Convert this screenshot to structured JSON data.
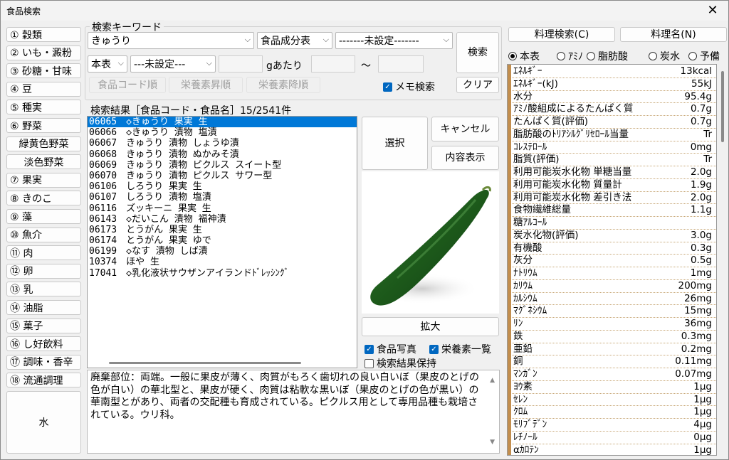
{
  "window": {
    "title": "食品検索",
    "close_glyph": "✕"
  },
  "categories": [
    "① 穀類",
    "② いも・澱粉",
    "③ 砂糖・甘味",
    "④ 豆",
    "⑤ 種実",
    "⑥ 野菜",
    "緑黄色野菜",
    "淡色野菜",
    "⑦ 果実",
    "⑧ きのこ",
    "⑨ 藻",
    "⑩ 魚介",
    "⑪ 肉",
    "⑫ 卵",
    "⑬ 乳",
    "⑭ 油脂",
    "⑮ 菓子",
    "⑯ し好飲料",
    "⑰ 調味・香辛",
    "⑱ 流通調理"
  ],
  "water_button": "水",
  "search": {
    "group_label": "検索キーワード",
    "keyword": "きゅうり",
    "table_select": "食品成分表",
    "unset_select_1": "-------未設定-------",
    "table_select_2": "本表",
    "unset_select_2": "---未設定---",
    "per_g_label": "gあたり",
    "range_sep": "～",
    "search_button": "検索",
    "clear_button": "クリア",
    "memo_search_label": "メモ検索",
    "sort_code": "食品コード順",
    "sort_asc": "栄養素昇順",
    "sort_desc": "栄養素降順"
  },
  "results": {
    "header": "検索結果［食品コード・食品名］15/2541件",
    "items": [
      "06065　◇きゅうり 果実 生",
      "06066　◇きゅうり 漬物 塩漬",
      "06067　きゅうり 漬物 しょうゆ漬",
      "06068　きゅうり 漬物 ぬかみそ漬",
      "06069　きゅうり 漬物 ピクルス スイート型",
      "06070　きゅうり 漬物 ピクルス サワー型",
      "06106　しろうり 果実 生",
      "06107　しろうり 漬物 塩漬",
      "06116　ズッキーニ 果実 生",
      "06143　◇だいこん 漬物 福神漬",
      "06173　とうがん 果実 生",
      "06174　とうがん 果実 ゆで",
      "06199　◇なす 漬物 しば漬",
      "10374　ほや 生",
      "17041　◇乳化液状サウザンアイランドﾄﾞﾚｯｼﾝｸﾞ"
    ]
  },
  "actions": {
    "select": "選択",
    "cancel": "キャンセル",
    "details": "内容表示",
    "enlarge": "拡大",
    "food_photo": "食品写真",
    "nutrient_list": "栄養素一覧",
    "keep_results": "検索結果保持"
  },
  "memo": "廃棄部位：両端。一般に果皮が薄く、肉質がもろく歯切れの良い白いぼ（果皮のとげの色が白い）の華北型と、果皮が硬く、肉質は粘軟な黒いぼ（果皮のとげの色が黒い）の華南型とがあり、両者の交配種も育成されている。ピクルス用として専用品種も栽培されている。ウリ科。",
  "right": {
    "recipe_search": "料理検索(C)",
    "recipe_name": "料理名(N)",
    "radios": [
      "本表",
      "ｱﾐﾉ",
      "脂肪酸",
      "炭水",
      "予備"
    ],
    "selected_radio": "本表"
  },
  "nutrients": [
    {
      "name": "ｴﾈﾙｷﾞｰ",
      "value": "13kcal"
    },
    {
      "name": "ｴﾈﾙｷﾞｰ(kJ)",
      "value": "55kJ"
    },
    {
      "name": "水分",
      "value": "95.4g"
    },
    {
      "name": "ｱﾐﾉ酸組成によるたんぱく質",
      "value": "0.7g"
    },
    {
      "name": "たんぱく質(評価)",
      "value": "0.7g"
    },
    {
      "name": "脂肪酸のﾄﾘｱｼﾙｸﾞﾘｾﾛｰﾙ当量",
      "value": "Tr"
    },
    {
      "name": "ｺﾚｽﾃﾛｰﾙ",
      "value": "0mg"
    },
    {
      "name": "脂質(評価)",
      "value": "Tr"
    },
    {
      "name": "利用可能炭水化物 単糖当量",
      "value": "2.0g"
    },
    {
      "name": "利用可能炭水化物 質量計",
      "value": "1.9g"
    },
    {
      "name": "利用可能炭水化物 差引き法",
      "value": "2.0g"
    },
    {
      "name": "食物繊維総量",
      "value": "1.1g"
    },
    {
      "name": "糖ｱﾙｺｰﾙ",
      "value": ""
    },
    {
      "name": "炭水化物(評価)",
      "value": "3.0g"
    },
    {
      "name": "有機酸",
      "value": "0.3g"
    },
    {
      "name": "灰分",
      "value": "0.5g"
    },
    {
      "name": "ﾅﾄﾘｳﾑ",
      "value": "1mg"
    },
    {
      "name": "ｶﾘｳﾑ",
      "value": "200mg"
    },
    {
      "name": "ｶﾙｼｳﾑ",
      "value": "26mg"
    },
    {
      "name": "ﾏｸﾞﾈｼｳﾑ",
      "value": "15mg"
    },
    {
      "name": "ﾘﾝ",
      "value": "36mg"
    },
    {
      "name": "鉄",
      "value": "0.3mg"
    },
    {
      "name": "亜鉛",
      "value": "0.2mg"
    },
    {
      "name": "銅",
      "value": "0.11mg"
    },
    {
      "name": "ﾏﾝｶﾞﾝ",
      "value": "0.07mg"
    },
    {
      "name": "ﾖｳ素",
      "value": "1μg"
    },
    {
      "name": "ｾﾚﾝ",
      "value": "1μg"
    },
    {
      "name": "ｸﾛﾑ",
      "value": "1μg"
    },
    {
      "name": "ﾓﾘﾌﾞﾃﾞﾝ",
      "value": "4μg"
    },
    {
      "name": "ﾚﾁﾉｰﾙ",
      "value": "0μg"
    },
    {
      "name": "αｶﾛﾃﾝ",
      "value": "1μg"
    }
  ],
  "colors": {
    "selection": "#0078d7",
    "checkbox": "#0067c0",
    "nutrient_bar": "#c28e4e"
  },
  "icons": {
    "close": "close-icon",
    "dropdown": "chevron-down-icon",
    "check": "checkmark-icon"
  }
}
